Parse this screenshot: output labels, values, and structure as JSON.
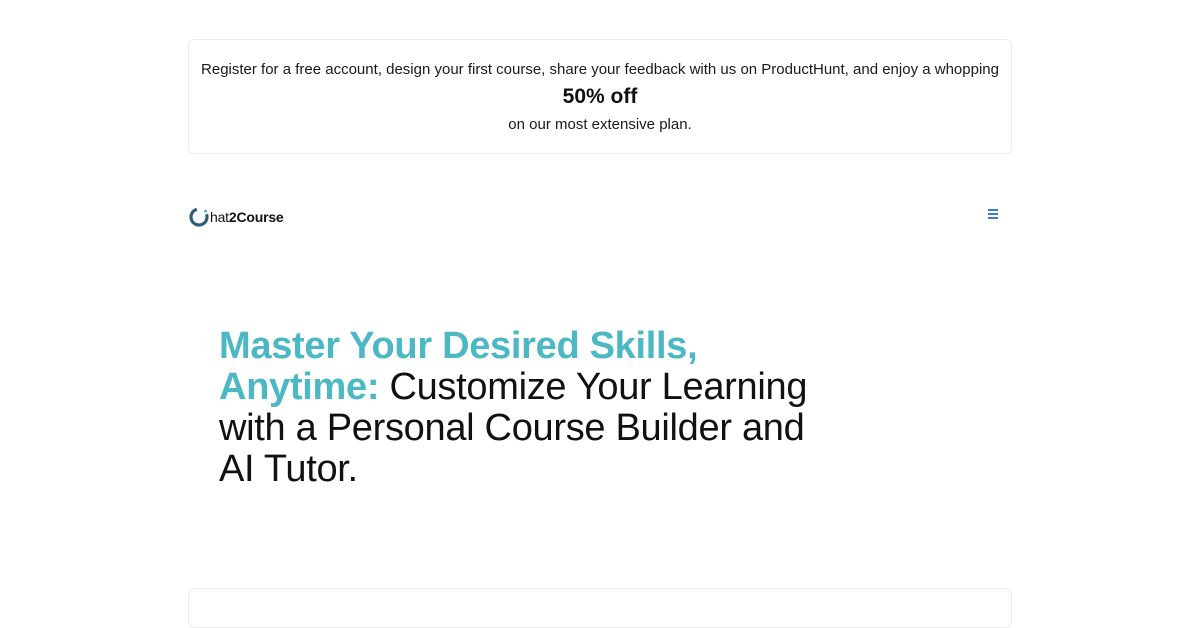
{
  "banner": {
    "line1": "Register for a free account, design your first course, share your feedback with us on ProductHunt, and enjoy a whopping",
    "offer": "50% off",
    "line2": "on our most extensive plan."
  },
  "header": {
    "logo": {
      "prefix": "hat",
      "number": "2",
      "suffix": "Course",
      "mark_icon": "c-ring-logo-icon"
    },
    "menu_icon": "hamburger-icon"
  },
  "hero": {
    "highlight": "Master Your Desired Skills, Anytime:",
    "rest": " Customize Your Learning with a Personal Course Builder and AI Tutor."
  },
  "colors": {
    "accent": "#4bb8c4",
    "menu_icon": "#3a7bd5",
    "text": "#111111",
    "border": "#ececec"
  }
}
